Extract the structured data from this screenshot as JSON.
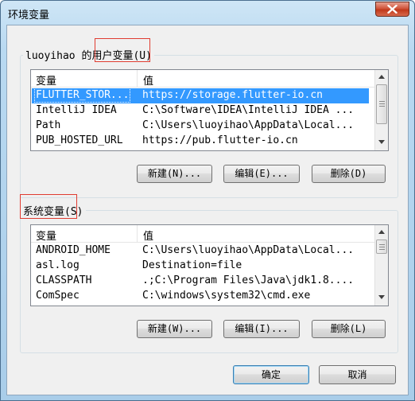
{
  "window": {
    "title": "环境变量"
  },
  "user_vars": {
    "group_label_prefix": "luoyihao 的",
    "group_label_highlight": "用户变量",
    "group_label_suffix": "(U)",
    "columns": [
      "变量",
      "值"
    ],
    "rows": [
      {
        "name": "FLUTTER_STOR...",
        "value": "https://storage.flutter-io.cn",
        "selected": true
      },
      {
        "name": "IntelliJ IDEA",
        "value": "C:\\Software\\IDEA\\IntelliJ IDEA ..."
      },
      {
        "name": "Path",
        "value": "C:\\Users\\luoyihao\\AppData\\Local..."
      },
      {
        "name": "PUB_HOSTED_URL",
        "value": "https://pub.flutter-io.cn"
      }
    ],
    "buttons": {
      "new": "新建(N)...",
      "edit": "编辑(E)...",
      "delete": "删除(D)"
    }
  },
  "system_vars": {
    "group_label_highlight": "系统变量",
    "group_label_suffix": "(S)",
    "columns": [
      "变量",
      "值"
    ],
    "rows": [
      {
        "name": "ANDROID_HOME",
        "value": "C:\\Users\\luoyihao\\AppData\\Local..."
      },
      {
        "name": "asl.log",
        "value": "Destination=file"
      },
      {
        "name": "CLASSPATH",
        "value": ".;C:\\Program Files\\Java\\jdk1.8...."
      },
      {
        "name": "ComSpec",
        "value": "C:\\windows\\system32\\cmd.exe"
      }
    ],
    "buttons": {
      "new": "新建(W)...",
      "edit": "编辑(I)...",
      "delete": "删除(L)"
    }
  },
  "dialog_buttons": {
    "ok": "确定",
    "cancel": "取消"
  },
  "colors": {
    "selection": "#3399ff",
    "annotation_box": "#e03c31"
  }
}
